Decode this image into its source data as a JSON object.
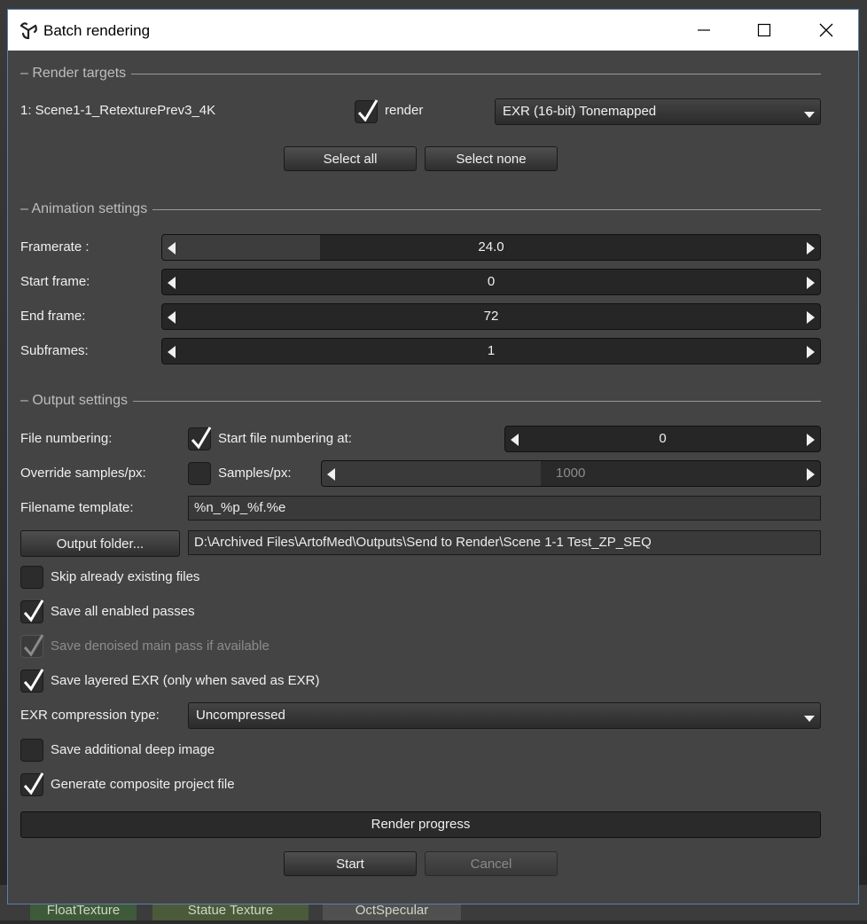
{
  "window": {
    "title": "Batch rendering"
  },
  "background_tabs": [
    "FloatTexture",
    "Statue Texture",
    "OctSpecular"
  ],
  "render_targets": {
    "section_label": "Render targets",
    "target_name": "1: Scene1-1_RetexturePrev3_4K",
    "render_checked": true,
    "render_label": "render",
    "format_value": "EXR (16-bit) Tonemapped",
    "select_all": "Select all",
    "select_none": "Select none"
  },
  "animation": {
    "section_label": "Animation settings",
    "framerate_label": "Framerate :",
    "framerate_value": "24.0",
    "framerate_fill": 0.24,
    "start_label": "Start frame:",
    "start_value": "0",
    "end_label": "End frame:",
    "end_value": "72",
    "subframes_label": "Subframes:",
    "subframes_value": "1"
  },
  "output": {
    "section_label": "Output settings",
    "file_numbering_label": "File numbering:",
    "start_numbering_checked": true,
    "start_numbering_label": "Start file numbering at:",
    "start_numbering_value": "0",
    "override_label": "Override samples/px:",
    "override_checked": false,
    "samples_label": "Samples/px:",
    "samples_value": "1000",
    "samples_fill": 0.44,
    "filename_template_label": "Filename template:",
    "filename_template_value": "%n_%p_%f.%e",
    "output_folder_button": "Output folder...",
    "output_folder_value": "D:\\Archived Files\\ArtofMed\\Outputs\\Send to Render\\Scene 1-1 Test_ZP_SEQ",
    "skip_existing_label": "Skip already existing files",
    "skip_existing_checked": false,
    "save_all_passes_label": "Save all enabled passes",
    "save_all_passes_checked": true,
    "save_denoised_label": "Save denoised main pass if available",
    "save_denoised_checked": true,
    "save_layered_label": "Save layered EXR (only when saved as EXR)",
    "save_layered_checked": true,
    "exr_compression_label": "EXR compression type:",
    "exr_compression_value": "Uncompressed",
    "deep_image_label": "Save additional deep image",
    "deep_image_checked": false,
    "composite_label": "Generate composite project file",
    "composite_checked": true
  },
  "progress": {
    "label": "Render progress",
    "value": 0
  },
  "footer": {
    "start": "Start",
    "cancel": "Cancel"
  },
  "colors": {
    "accent_border": "#5a7fa8",
    "panel": "#444444"
  }
}
